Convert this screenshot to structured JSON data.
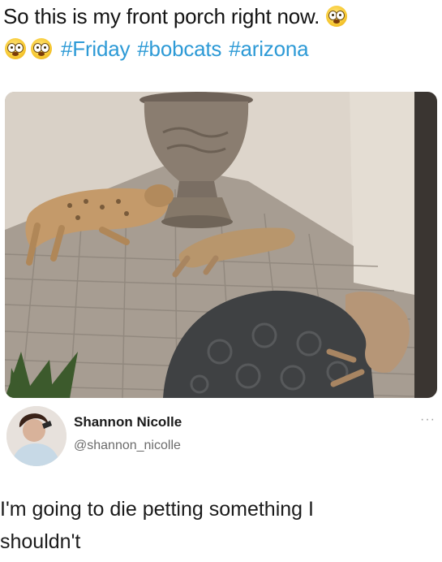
{
  "caption": {
    "text": "So this is my front porch right now.",
    "emoji": "flushed-face-emoji",
    "hashtags": [
      "#Friday",
      "#bobcats",
      "#arizona"
    ],
    "colors": {
      "hashtag": "#2d9ad6",
      "text": "#141414"
    }
  },
  "photo": {
    "subject": "bobcats lying on brick porch beside urn and doormat"
  },
  "reply": {
    "name": "Shannon Nicolle",
    "handle": "@shannon_nicolle",
    "more_icon": "more-options-icon",
    "text_line1": "I'm going to die petting something I",
    "text_line2": "shouldn't"
  }
}
